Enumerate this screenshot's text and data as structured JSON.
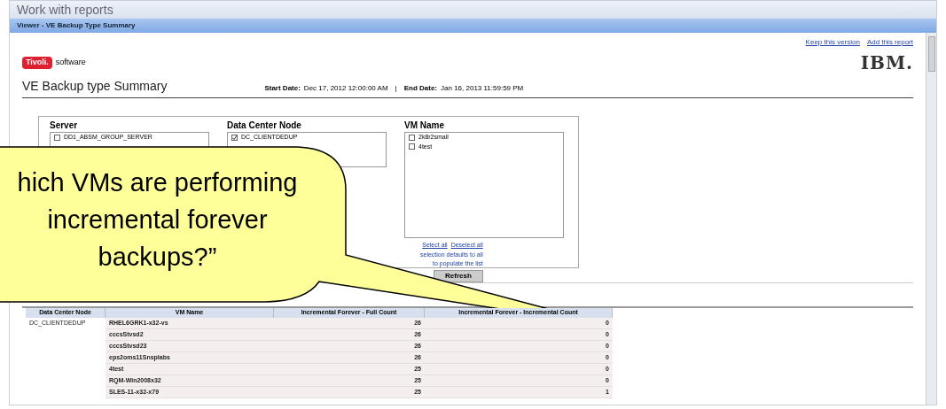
{
  "window": {
    "title": "Work with reports"
  },
  "viewer_bar": {
    "title": "Viewer - VE Backup Type Summary"
  },
  "toolbar": {
    "links": [
      "Keep this version",
      "Add this report"
    ]
  },
  "brand": {
    "badge": "Tivoli.",
    "text": "software",
    "logo": "IBM."
  },
  "report": {
    "title": "VE Backup type Summary",
    "start_label": "Start Date:",
    "start_value": "Dec 17, 2012 12:00:00 AM",
    "separator": "|",
    "end_label": "End Date:",
    "end_value": "Jan 16, 2013 11:59:59 PM"
  },
  "filters": [
    {
      "label": "Server",
      "items": [
        {
          "text": "DD1_ABSM_GROUP_SERVER",
          "checked": false
        }
      ]
    },
    {
      "label": "Data Center Node",
      "items": [
        {
          "text": "DC_CLIENTDEDUP",
          "checked": true
        }
      ]
    },
    {
      "label": "VM Name",
      "items": [
        {
          "text": "2k8r2small",
          "checked": false
        },
        {
          "text": "4test",
          "checked": false
        }
      ]
    }
  ],
  "filter_links": [
    "Select all",
    "Deselect all"
  ],
  "filter_hint": [
    "selection defaults to all",
    "to populate the list"
  ],
  "refresh_button": "Refresh",
  "table": {
    "columns": [
      "Data Center Node",
      "VM Name",
      "Incremental Forever - Full Count",
      "Incremental Forever - Incremental Count"
    ],
    "rows": [
      [
        "DC_CLIENTDEDUP",
        "RHEL6GRK1-x32-vs",
        "26",
        "0"
      ],
      [
        "",
        "cccsStvsd2",
        "26",
        "0"
      ],
      [
        "",
        "cccsStvsd23",
        "26",
        "0"
      ],
      [
        "",
        "eps2oms11Snsplabs",
        "26",
        "0"
      ],
      [
        "",
        "4test",
        "25",
        "0"
      ],
      [
        "",
        "RQM-Win2008x32",
        "25",
        "0"
      ],
      [
        "",
        "SLES-11-x32-x79",
        "25",
        "1"
      ]
    ]
  },
  "callout": {
    "text": "hich VMs are performing incremental forever backups?”"
  }
}
